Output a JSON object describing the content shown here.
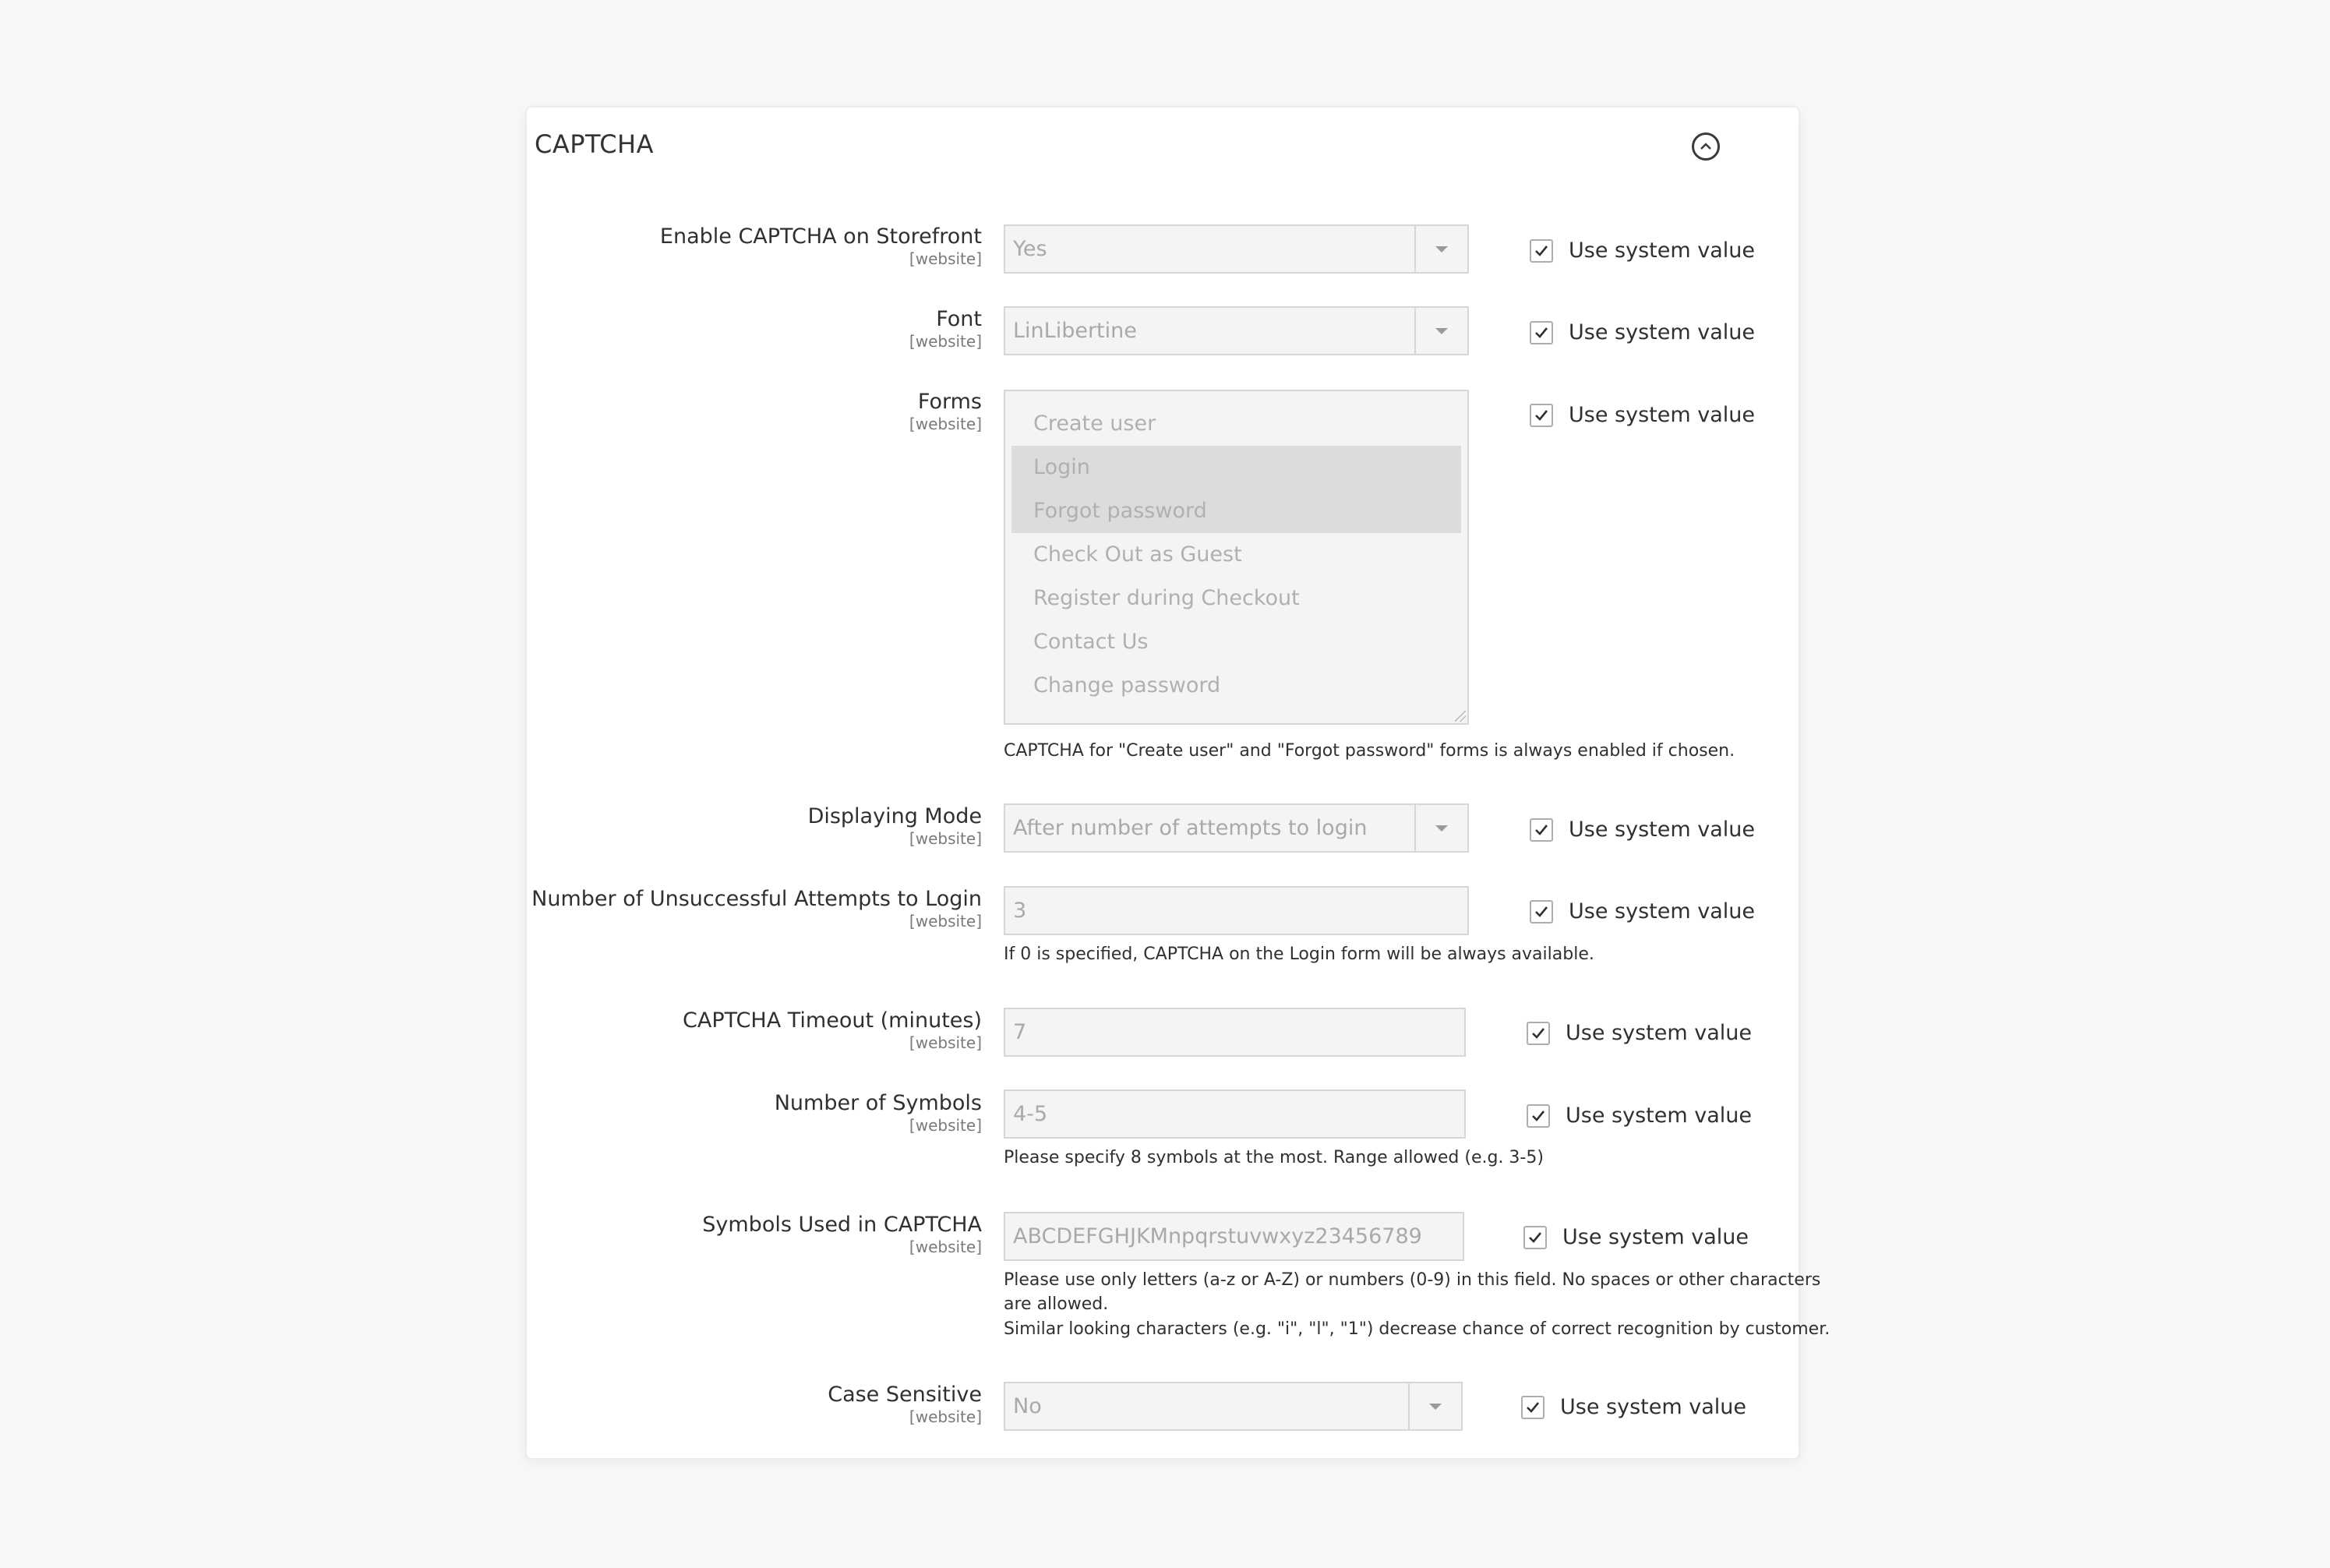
{
  "section": {
    "title": "CAPTCHA",
    "collapse_icon": "chevron-up-circle-icon"
  },
  "scope_label": "[website]",
  "use_system_value_label": "Use system value",
  "fields": {
    "enable_storefront": {
      "label": "Enable CAPTCHA on Storefront",
      "value": "Yes",
      "use_system_value": true
    },
    "font": {
      "label": "Font",
      "value": "LinLibertine",
      "use_system_value": true
    },
    "forms": {
      "label": "Forms",
      "options": [
        {
          "label": "Create user",
          "selected": false
        },
        {
          "label": "Login",
          "selected": true
        },
        {
          "label": "Forgot password",
          "selected": true
        },
        {
          "label": "Check Out as Guest",
          "selected": false
        },
        {
          "label": "Register during Checkout",
          "selected": false
        },
        {
          "label": "Contact Us",
          "selected": false
        },
        {
          "label": "Change password",
          "selected": false
        }
      ],
      "note": "CAPTCHA for \"Create user\" and \"Forgot password\" forms is always enabled if chosen.",
      "use_system_value": true
    },
    "displaying_mode": {
      "label": "Displaying Mode",
      "value": "After number of attempts to login",
      "use_system_value": true
    },
    "attempts": {
      "label": "Number of Unsuccessful Attempts to Login",
      "value": "3",
      "note": "If 0 is specified, CAPTCHA on the Login form will be always available.",
      "use_system_value": true
    },
    "timeout": {
      "label": "CAPTCHA Timeout (minutes)",
      "value": "7",
      "use_system_value": true
    },
    "symbols_count": {
      "label": "Number of Symbols",
      "value": "4-5",
      "note": "Please specify 8 symbols at the most. Range allowed (e.g. 3-5)",
      "use_system_value": true
    },
    "symbols_used": {
      "label": "Symbols Used in CAPTCHA",
      "value": "ABCDEFGHJKMnpqrstuvwxyz23456789",
      "note_line1": "Please use only letters (a-z or A-Z) or numbers (0-9) in this field. No spaces or other characters",
      "note_line2": "are allowed.",
      "note_line3": "Similar looking characters (e.g. \"i\", \"l\", \"1\") decrease chance of correct recognition by customer.",
      "use_system_value": true
    },
    "case_sensitive": {
      "label": "Case Sensitive",
      "value": "No",
      "use_system_value": true
    }
  }
}
